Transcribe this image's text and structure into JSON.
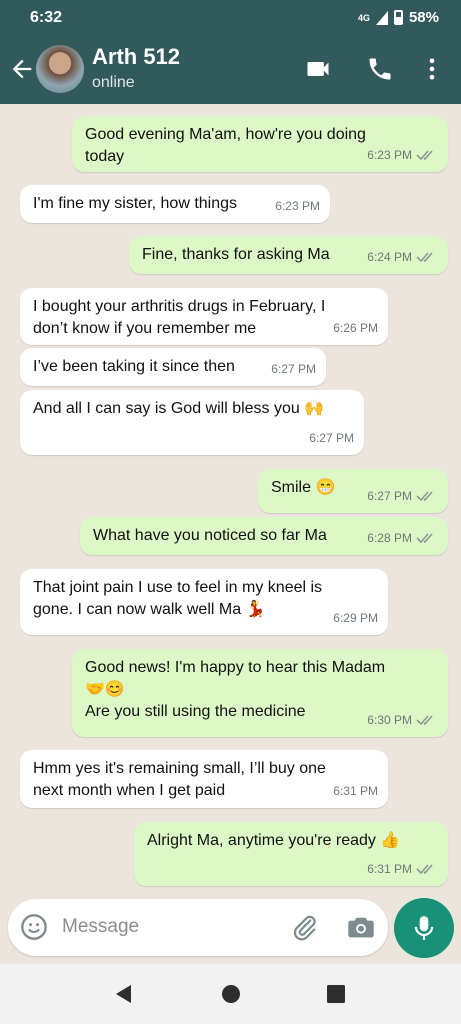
{
  "status_bar": {
    "time": "6:32",
    "signal": "4G",
    "battery": "58%"
  },
  "header": {
    "contact_name": "Arth 512",
    "status": "online"
  },
  "messages": [
    {
      "dir": "out",
      "text": "Good evening Ma'am, how're you doing\ntoday",
      "time": "6:23 PM"
    },
    {
      "dir": "in",
      "text": "I'm fine my sister, how things",
      "time": "6:23 PM"
    },
    {
      "dir": "out",
      "text": "Fine, thanks for asking Ma",
      "time": "6:24 PM"
    },
    {
      "dir": "in",
      "text": "I bought your arthritis drugs in February, I\ndon’t know if you remember me",
      "time": "6:26 PM"
    },
    {
      "dir": "in",
      "text": "I’ve been taking it since then",
      "time": "6:27 PM"
    },
    {
      "dir": "in",
      "text": "And all I can say is God will bless you 🙌",
      "time": "6:27 PM"
    },
    {
      "dir": "out",
      "text": "Smile 😁",
      "time": "6:27 PM"
    },
    {
      "dir": "out",
      "text": "What have you noticed so far Ma",
      "time": "6:28 PM"
    },
    {
      "dir": "in",
      "text": "That joint pain I use to feel in my kneel is\ngone. I can now walk well Ma 💃",
      "time": "6:29 PM"
    },
    {
      "dir": "out",
      "text": "Good news! I'm happy to hear this Madam\n🤝😊\nAre you still using the medicine",
      "time": "6:30 PM"
    },
    {
      "dir": "in",
      "text": "Hmm yes it's remaining small, I’ll buy one\nnext month when I get paid",
      "time": "6:31 PM"
    },
    {
      "dir": "out",
      "text": "Alright Ma, anytime you're ready 👍",
      "time": "6:31 PM"
    }
  ],
  "composer": {
    "placeholder": "Message"
  },
  "icons": {
    "back": "arrow-left-icon",
    "video": "video-call-icon",
    "call": "phone-icon",
    "menu": "more-vert-icon",
    "emoji": "emoji-icon",
    "attach": "paperclip-icon",
    "camera": "camera-icon",
    "mic": "mic-icon",
    "nav_back": "nav-back-icon",
    "nav_home": "nav-home-icon",
    "nav_recents": "nav-recents-icon"
  },
  "colors": {
    "header": "#32595c",
    "outgoing_bubble": "#dcf8c6",
    "incoming_bubble": "#ffffff",
    "chat_bg": "#ece5dd",
    "mic_button": "#199179"
  }
}
